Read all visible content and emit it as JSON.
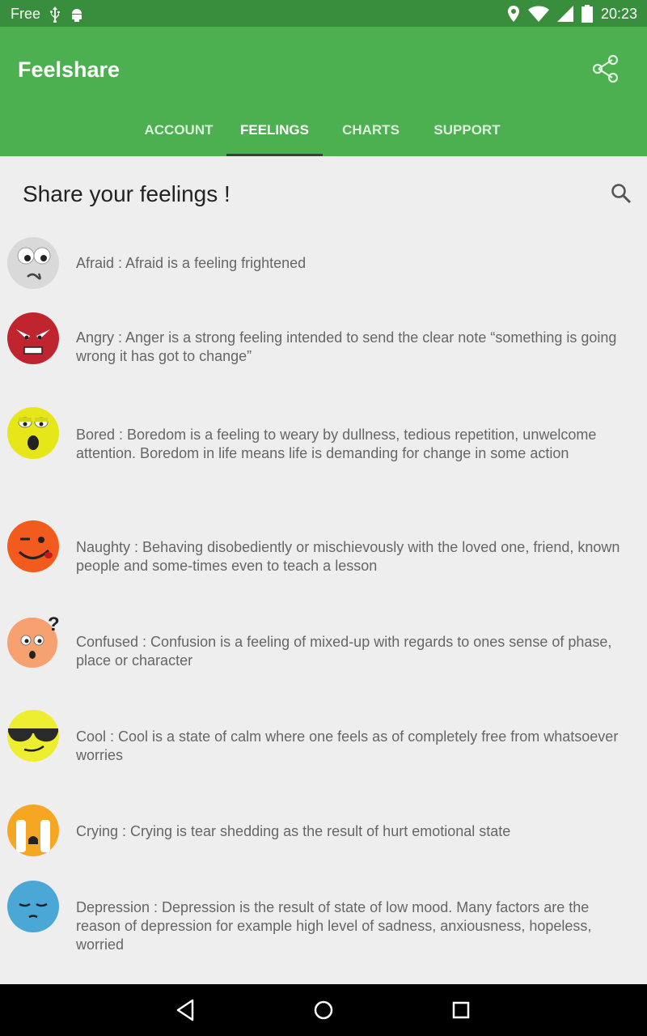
{
  "status_bar": {
    "carrier": "Free",
    "time": "20:23",
    "icons": [
      "usb-icon",
      "android-debug-icon",
      "location-icon",
      "wifi-icon",
      "signal-icon",
      "battery-icon"
    ]
  },
  "app_bar": {
    "title": "Feelshare",
    "share_icon": "share-icon"
  },
  "tabs": [
    {
      "label": "ACCOUNT",
      "active": false
    },
    {
      "label": "FEELINGS",
      "active": true
    },
    {
      "label": "CHARTS",
      "active": false
    },
    {
      "label": "SUPPORT",
      "active": false
    }
  ],
  "main": {
    "header": "Share your feelings !",
    "search_icon": "search-icon",
    "feelings": [
      {
        "icon": "afraid-emoji-icon",
        "text": "Afraid : Afraid is a feeling frightened"
      },
      {
        "icon": "angry-emoji-icon",
        "text": "Angry : Anger is a strong feeling intended to send the clear note “something is going wrong it has got to change”"
      },
      {
        "icon": "bored-emoji-icon",
        "text": "Bored : Boredom is a feeling to weary by dullness, tedious repetition, unwelcome attention. Boredom in life means life is demanding for change in some action"
      },
      {
        "icon": "naughty-emoji-icon",
        "text": "Naughty : Behaving disobediently or mischievously with the loved one, friend, known people and some-times even to teach a lesson"
      },
      {
        "icon": "confused-emoji-icon",
        "text": "Confused : Confusion is a feeling of mixed-up with regards to ones sense of phase, place or character"
      },
      {
        "icon": "cool-emoji-icon",
        "text": "Cool : Cool is a state of calm where one feels as of completely free from whatsoever worries"
      },
      {
        "icon": "crying-emoji-icon",
        "text": "Crying : Crying is tear shedding as the result of hurt emotional state"
      },
      {
        "icon": "depression-emoji-icon",
        "text": "Depression : Depression is the result of state of low mood. Many factors are the reason of depression for example high level of sadness, anxiousness, hopeless, worried"
      }
    ]
  },
  "nav_bar": {
    "buttons": [
      "back-icon",
      "home-icon",
      "recents-icon"
    ]
  },
  "colors": {
    "primary": "#4caf50",
    "primary_dark": "#388e3c",
    "background": "#eeeeee",
    "text": "#666666"
  }
}
